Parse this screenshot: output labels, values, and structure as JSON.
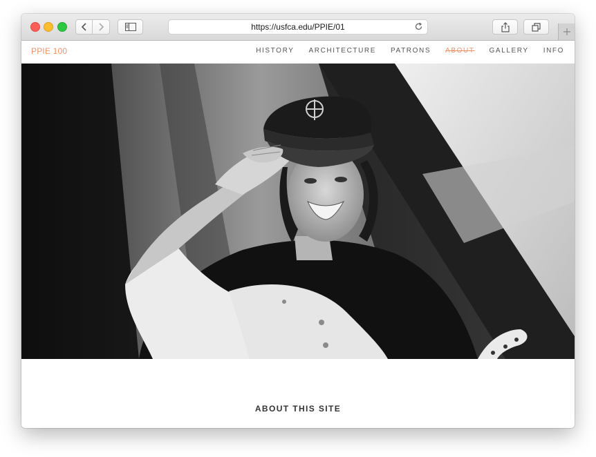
{
  "browser": {
    "url": "https://usfca.edu/PPIE/01",
    "icons": {
      "back": "chevron-left-icon",
      "forward": "chevron-right-icon",
      "sidebar": "sidebar-icon",
      "reload": "reload-icon",
      "share": "share-icon",
      "tabs": "tabs-icon",
      "new_tab": "plus-icon"
    }
  },
  "site": {
    "logo": "PPIE 100",
    "nav": [
      {
        "label": "HISTORY"
      },
      {
        "label": "ARCHITECTURE"
      },
      {
        "label": "PATRONS"
      },
      {
        "label": "ABOUT"
      },
      {
        "label": "GALLERY"
      },
      {
        "label": "INFO"
      }
    ],
    "active_nav": "ABOUT",
    "accent_color": "#f0936b"
  },
  "main": {
    "section_title": "ABOUT THIS SITE"
  }
}
